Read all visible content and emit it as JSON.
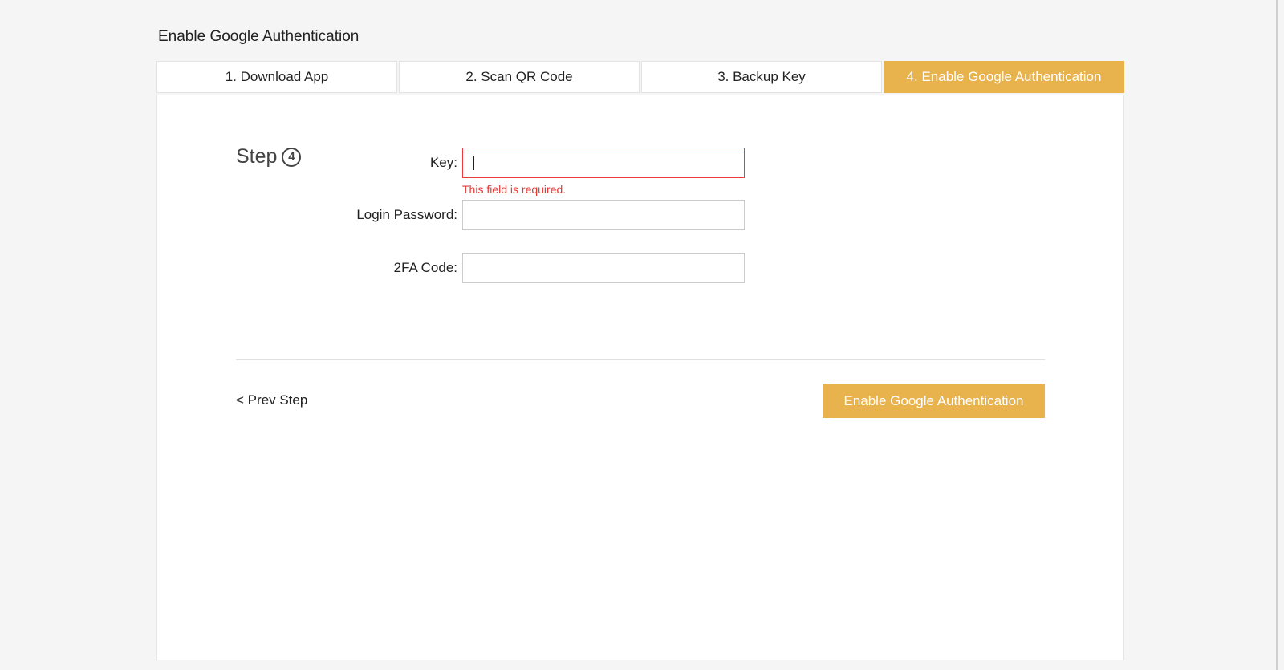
{
  "page": {
    "title": "Enable Google Authentication"
  },
  "tabs": [
    {
      "label": "1. Download App",
      "active": false
    },
    {
      "label": "2. Scan QR Code",
      "active": false
    },
    {
      "label": "3. Backup Key",
      "active": false
    },
    {
      "label": "4. Enable Google Authentication",
      "active": true
    }
  ],
  "step": {
    "label": "Step",
    "number": "4"
  },
  "form": {
    "key": {
      "label": "Key:",
      "value": "",
      "error": "This field is required."
    },
    "login_password": {
      "label": "Login Password:",
      "value": ""
    },
    "twofa_code": {
      "label": "2FA Code:",
      "value": ""
    }
  },
  "actions": {
    "prev_label": "< Prev Step",
    "submit_label": "Enable Google Authentication"
  },
  "colors": {
    "accent": "#e8b24c",
    "error": "#e53935"
  }
}
